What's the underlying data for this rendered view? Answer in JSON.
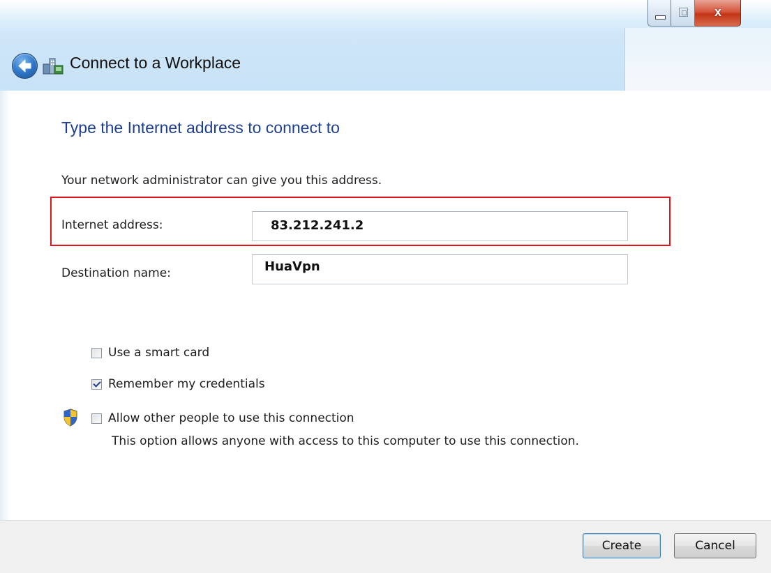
{
  "window": {
    "title": "Connect to a Workplace",
    "controls": {
      "minimize_icon": "minimize-icon",
      "maximize_icon": "maximize-icon",
      "close_icon": "close-icon",
      "close_glyph": "x"
    }
  },
  "page": {
    "heading": "Type the Internet address to connect to",
    "description": "Your network administrator can give you this address."
  },
  "form": {
    "internet_address": {
      "label": "Internet address:",
      "value": "83.212.241.2"
    },
    "destination_name": {
      "label": "Destination name:",
      "value": "HuaVpn"
    }
  },
  "options": {
    "smart_card": {
      "label": "Use a smart card",
      "checked": false
    },
    "remember_credentials": {
      "label": "Remember my credentials",
      "checked": true
    },
    "allow_others": {
      "label": "Allow other people to use this connection",
      "checked": false,
      "note": "This option allows anyone with access to this computer to use this connection."
    }
  },
  "buttons": {
    "create": "Create",
    "cancel": "Cancel"
  },
  "colors": {
    "heading": "#1e3f8f",
    "highlight_border": "#e0141c",
    "titlebar": "#cfe6f8"
  }
}
